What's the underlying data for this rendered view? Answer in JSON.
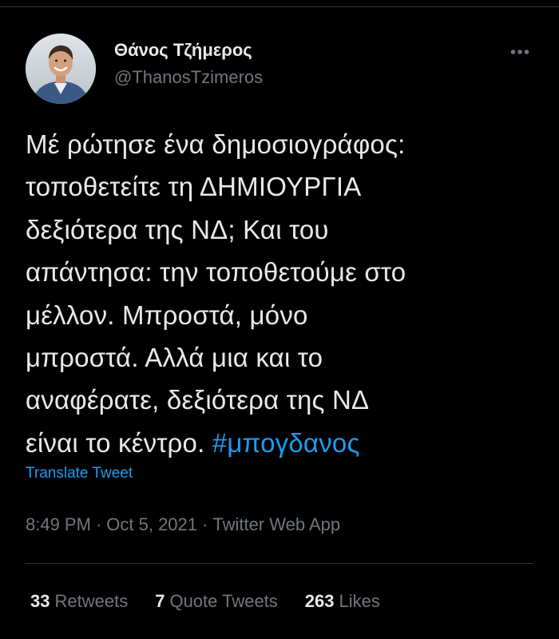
{
  "author": {
    "name": "Θάνος Τζήμερος",
    "handle": "@ThanosTzimeros"
  },
  "tweet": {
    "lines": [
      "Μέ ρώτησε ένα δημοσιογράφος:",
      "τοποθετείτε τη ΔΗΜΙΟΥΡΓΙΑ",
      "δεξιότερα της ΝΔ; Και του",
      "απάντησα: την τοποθετούμε στο",
      "μέλλον. Μπροστά, μόνο",
      "μπροστά. Αλλά μια και το",
      "αναφέρατε, δεξιότερα της ΝΔ"
    ],
    "last_line_text": "είναι το κέντρο. ",
    "hashtag": "#μπογδανος",
    "translate_label": "Translate Tweet"
  },
  "meta": {
    "time": "8:49 PM",
    "separator": "·",
    "date": "Oct 5, 2021",
    "source": "Twitter Web App"
  },
  "stats": {
    "retweets_count": "33",
    "retweets_label": "Retweets",
    "quotes_count": "7",
    "quotes_label": "Quote Tweets",
    "likes_count": "263",
    "likes_label": "Likes"
  },
  "icons": {
    "more": "more-horizontal-icon",
    "avatar": "avatar"
  },
  "colors": {
    "background": "#000000",
    "text": "#e7e9ea",
    "muted": "#71767b",
    "link": "#1d9bf0",
    "divider": "#2f3336"
  }
}
